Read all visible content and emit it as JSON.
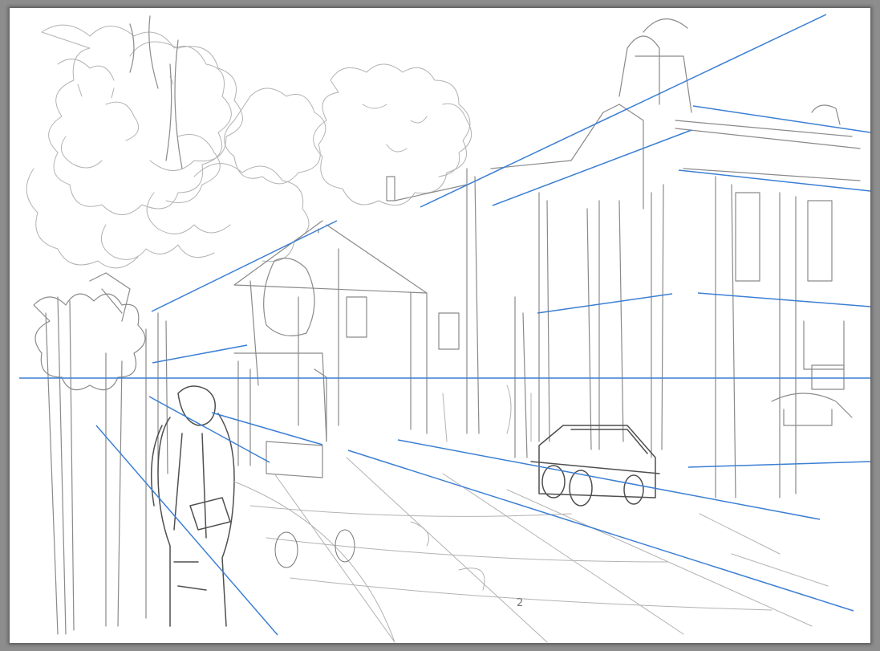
{
  "colors": {
    "backdrop": "#8d8d8d",
    "paper": "#ffffff",
    "pencil": "#777777",
    "perspective_line": "#3b7fd4"
  },
  "sketch_marks": {
    "road_number": "2"
  }
}
